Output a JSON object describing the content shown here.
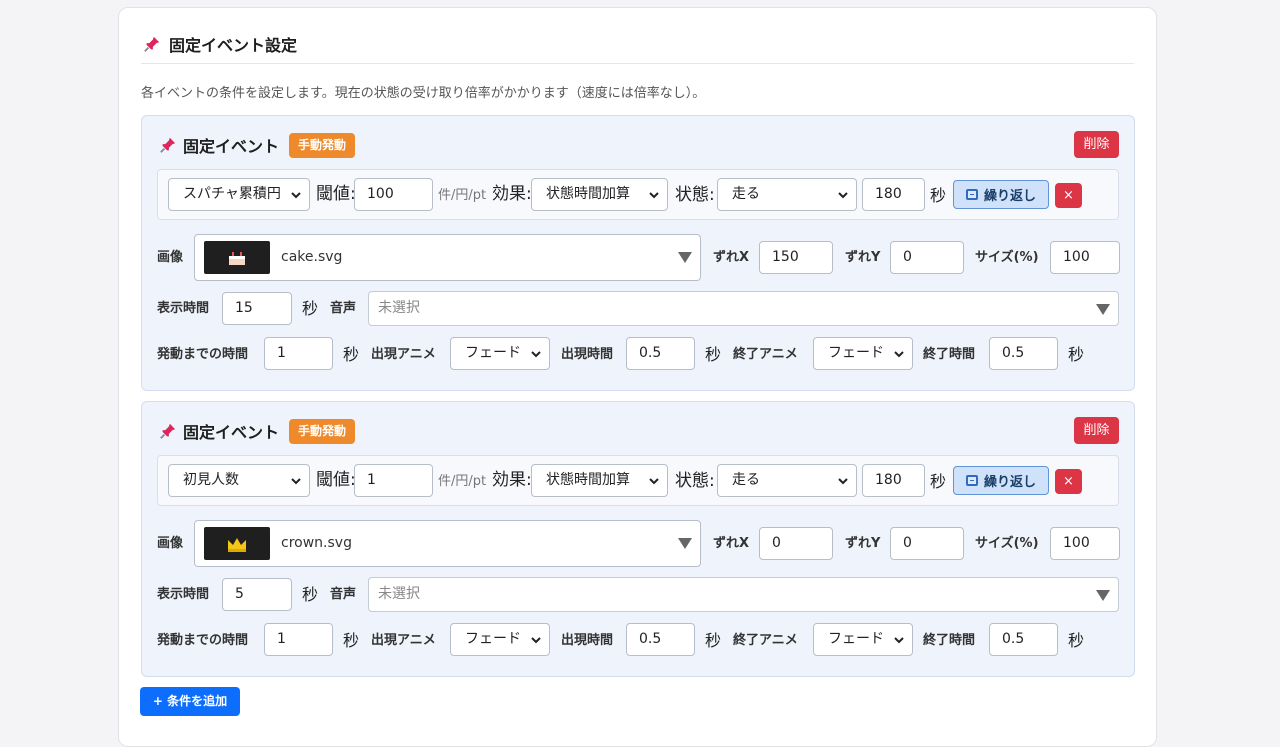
{
  "panel": {
    "title": "固定イベント設定",
    "description": "各イベントの条件を設定します。現在の状態の受け取り倍率がかかります（速度には倍率なし）。"
  },
  "labels": {
    "threshold": "閾値:",
    "unit_hint": "件/円/pt",
    "effect": "効果:",
    "state": "状態:",
    "sec": "秒",
    "image": "画像",
    "offset_x": "ずれX",
    "offset_y": "ずれY",
    "size": "サイズ(%)",
    "display_time": "表示時間",
    "audio": "音声",
    "delay": "発動までの時間",
    "appear_anim": "出現アニメ",
    "appear_time": "出現時間",
    "end_anim": "終了アニメ",
    "end_time": "終了時間"
  },
  "events": [
    {
      "title": "固定イベント",
      "badge": "手動発動",
      "delete_label": "削除",
      "condition": "スパチャ累積円",
      "threshold": "100",
      "effect": "状態時間加算",
      "state": "走る",
      "state_seconds": "180",
      "repeat_label": "繰り返し",
      "remove_label": "×",
      "image_name": "cake.svg",
      "image_icon": "cake-icon",
      "offset_x": "150",
      "offset_y": "0",
      "size": "100",
      "display_time": "15",
      "audio_placeholder": "未選択",
      "delay": "1",
      "appear_anim": "フェード",
      "appear_time": "0.5",
      "end_anim": "フェード",
      "end_time": "0.5"
    },
    {
      "title": "固定イベント",
      "badge": "手動発動",
      "delete_label": "削除",
      "condition": "初見人数",
      "threshold": "1",
      "effect": "状態時間加算",
      "state": "走る",
      "state_seconds": "180",
      "repeat_label": "繰り返し",
      "remove_label": "×",
      "image_name": "crown.svg",
      "image_icon": "crown-icon",
      "offset_x": "0",
      "offset_y": "0",
      "size": "100",
      "display_time": "5",
      "audio_placeholder": "未選択",
      "delay": "1",
      "appear_anim": "フェード",
      "appear_time": "0.5",
      "end_anim": "フェード",
      "end_time": "0.5"
    }
  ],
  "add_button": "+ 条件を追加",
  "colors": {
    "event_bg": "#eef3fc",
    "badge": "#ee8a2c",
    "danger": "#dc3545",
    "primary": "#0d6efd",
    "pin": "#e0245e"
  }
}
